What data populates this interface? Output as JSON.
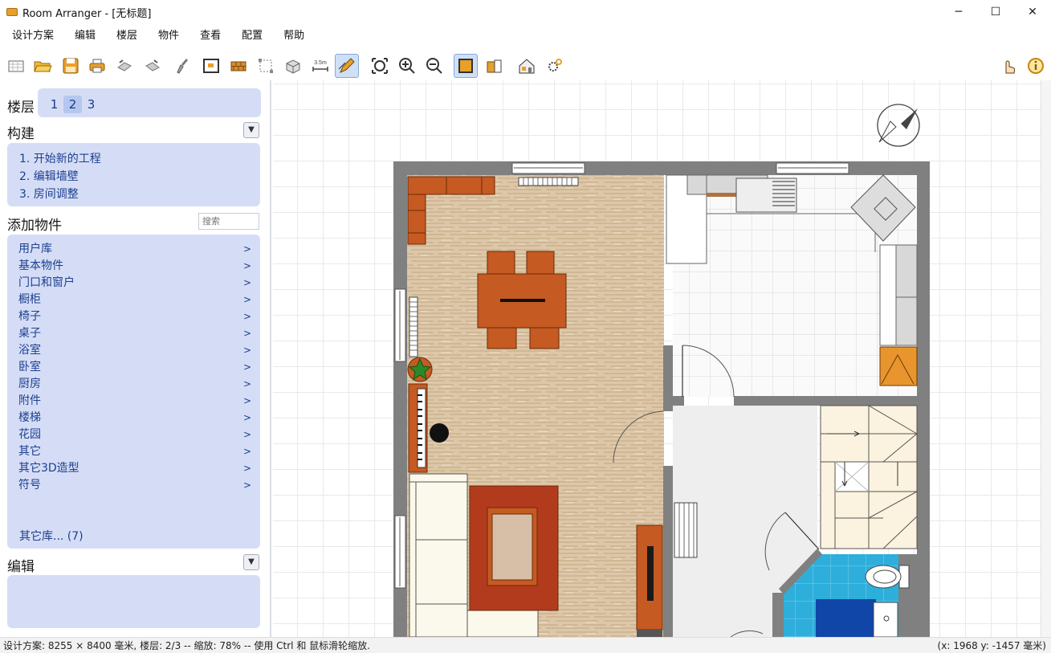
{
  "window": {
    "title": "Room Arranger - [无标题]",
    "controls": {
      "minimize": "─",
      "maximize": "☐",
      "close": "✕"
    }
  },
  "menubar": [
    "设计方案",
    "编辑",
    "楼层",
    "物件",
    "查看",
    "配置",
    "帮助"
  ],
  "toolbar": {
    "distance_icon_text": "3.5m",
    "buttons": [
      "new-project-icon",
      "open-icon",
      "save-icon",
      "print-icon",
      "undo-icon",
      "redo-icon",
      "paint-brush-icon",
      "floor-plan-icon",
      "brick-wall-icon",
      "select-area-icon",
      "3d-object-icon",
      "measure-distance-icon",
      "edit-walls-pencil-icon",
      "zoom-fit-icon",
      "zoom-in-icon",
      "zoom-out-icon",
      "top-view-box-icon",
      "3d-view-icon",
      "house-3d-icon",
      "settings-gears-icon",
      "hand-pointer-icon",
      "info-icon"
    ],
    "active": [
      "edit-walls-pencil-icon",
      "top-view-box-icon"
    ]
  },
  "left_panel": {
    "floors": {
      "label": "楼层",
      "items": [
        "1",
        "2",
        "3"
      ],
      "selected": "2"
    },
    "construct": {
      "title": "构建",
      "collapse_glyph": "▼",
      "steps": [
        "1. 开始新的工程",
        "2. 编辑墙壁",
        "3. 房间调整"
      ]
    },
    "add_objects": {
      "title": "添加物件",
      "search_placeholder": "搜索",
      "arrow_glyph": ">",
      "categories": [
        "用户库",
        "基本物件",
        "门口和窗户",
        "橱柜",
        "椅子",
        "桌子",
        "浴室",
        "卧室",
        "厨房",
        "附件",
        "楼梯",
        "花园",
        "其它",
        "其它3D造型",
        "符号"
      ],
      "other_libraries": "其它库... (7)"
    },
    "edit": {
      "title": "编辑",
      "collapse_glyph": "▼"
    }
  },
  "statusbar": {
    "left": "设计方案: 8255 × 8400 毫米, 楼层: 2/3 -- 缩放: 78% -- 使用 Ctrl 和 鼠标滑轮缩放.",
    "right": "(x: 1968 y: -1457 毫米)"
  },
  "colors": {
    "panel_bg": "#d5ddf6",
    "link": "#1d3f8f",
    "wall": "#808080",
    "wood_floor": "#d9c3a3",
    "furniture_orange": "#c55a22",
    "bath_tile": "#25a9d6",
    "bath_rug": "#1046a8"
  }
}
